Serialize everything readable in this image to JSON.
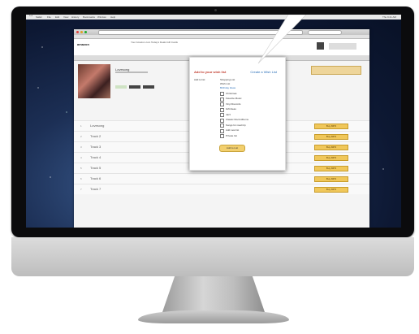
{
  "menubar": {
    "items": [
      "Safari",
      "File",
      "Edit",
      "View",
      "History",
      "Bookmarks",
      "Window",
      "Help"
    ],
    "clock": "Thu 9:41 AM"
  },
  "site": {
    "logo": "amazon",
    "nav": "Your Amazon.com  Today's Deals  Gift Cards"
  },
  "album": {
    "title": "Lovesong"
  },
  "popup": {
    "title": "Add to your wish list",
    "link": "Create a Wish List",
    "list_label": "Add to list:",
    "options": [
      "Shopping List",
      "Wish List",
      "Birthday Ideas"
    ],
    "checkbox_items": [
      "Christmas",
      "Favorite Music",
      "Vinyl Records",
      "Gift Ideas",
      "Jazz",
      "Classic Rock Albums",
      "Songs for road trip",
      "Add new list",
      "Private list"
    ],
    "add_button": "Add to List"
  },
  "tracks": [
    {
      "num": "1",
      "name": "Lovesong",
      "price": "Buy MP3"
    },
    {
      "num": "2",
      "name": "Track 2",
      "price": "Buy MP3"
    },
    {
      "num": "3",
      "name": "Track 3",
      "price": "Buy MP3"
    },
    {
      "num": "4",
      "name": "Track 4",
      "price": "Buy MP3"
    },
    {
      "num": "5",
      "name": "Track 5",
      "price": "Buy MP3"
    },
    {
      "num": "6",
      "name": "Track 6",
      "price": "Buy MP3"
    },
    {
      "num": "7",
      "name": "Track 7",
      "price": "Buy MP3"
    }
  ],
  "colors": {
    "accent_button": "#f0c75a",
    "popup_title": "#c0392b",
    "link": "#2a6eb8"
  }
}
